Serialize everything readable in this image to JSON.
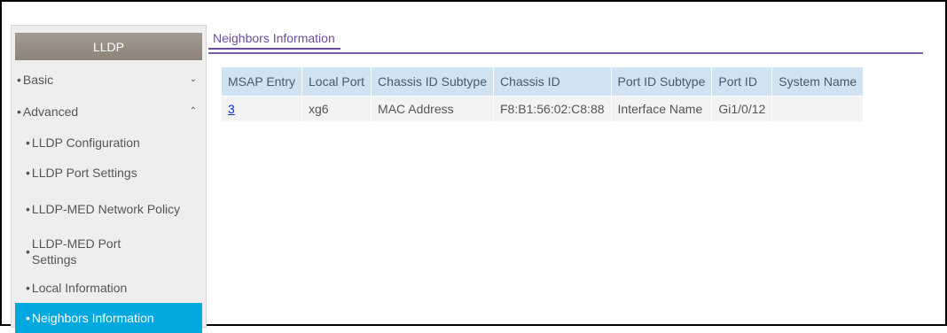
{
  "sidebar": {
    "title": "LLDP",
    "basic": {
      "label": "Basic",
      "icon": "chevron-down-icon"
    },
    "advanced": {
      "label": "Advanced",
      "icon": "chevron-up-icon"
    },
    "sub_items": [
      "LLDP Configuration",
      "LLDP Port Settings",
      "LLDP-MED Network Policy",
      "LLDP-MED Port Settings",
      "Local Information",
      "Neighbors Information"
    ],
    "active_item": "Neighbors Information"
  },
  "tab": {
    "label": "Neighbors Information"
  },
  "table": {
    "headers": [
      "MSAP Entry",
      "Local Port",
      "Chassis ID Subtype",
      "Chassis ID",
      "Port ID Subtype",
      "Port ID",
      "System Name"
    ],
    "rows": [
      {
        "msap_entry": "3",
        "local_port": "xg6",
        "chassis_id_subtype": "MAC Address",
        "chassis_id": "F8:B1:56:02:C8:88",
        "port_id_subtype": "Interface Name",
        "port_id": "Gi1/0/12",
        "system_name": ""
      }
    ]
  },
  "colors": {
    "accent_active": "#00a8e0",
    "tab_purple": "#6b4e9b",
    "header_blue": "#cfe3f2"
  }
}
